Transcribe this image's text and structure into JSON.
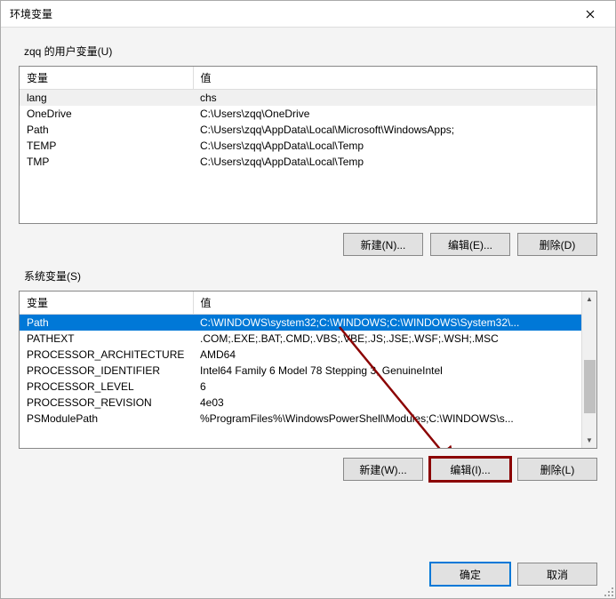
{
  "dialog": {
    "title": "环境变量",
    "close_icon": "close"
  },
  "user_vars": {
    "label": "zqq 的用户变量(U)",
    "headers": {
      "var": "变量",
      "val": "值"
    },
    "rows": [
      {
        "var": "lang",
        "val": "chs",
        "highlighted": true
      },
      {
        "var": "OneDrive",
        "val": "C:\\Users\\zqq\\OneDrive"
      },
      {
        "var": "Path",
        "val": "C:\\Users\\zqq\\AppData\\Local\\Microsoft\\WindowsApps;"
      },
      {
        "var": "TEMP",
        "val": "C:\\Users\\zqq\\AppData\\Local\\Temp"
      },
      {
        "var": "TMP",
        "val": "C:\\Users\\zqq\\AppData\\Local\\Temp"
      }
    ],
    "buttons": {
      "new": "新建(N)...",
      "edit": "编辑(E)...",
      "delete": "删除(D)"
    }
  },
  "system_vars": {
    "label": "系统变量(S)",
    "headers": {
      "var": "变量",
      "val": "值"
    },
    "rows": [
      {
        "var": "Path",
        "val": "C:\\WINDOWS\\system32;C:\\WINDOWS;C:\\WINDOWS\\System32\\...",
        "selected": true
      },
      {
        "var": "PATHEXT",
        "val": ".COM;.EXE;.BAT;.CMD;.VBS;.VBE;.JS;.JSE;.WSF;.WSH;.MSC"
      },
      {
        "var": "PROCESSOR_ARCHITECTURE",
        "val": "AMD64"
      },
      {
        "var": "PROCESSOR_IDENTIFIER",
        "val": "Intel64 Family 6 Model 78 Stepping 3, GenuineIntel"
      },
      {
        "var": "PROCESSOR_LEVEL",
        "val": "6"
      },
      {
        "var": "PROCESSOR_REVISION",
        "val": "4e03"
      },
      {
        "var": "PSModulePath",
        "val": "%ProgramFiles%\\WindowsPowerShell\\Modules;C:\\WINDOWS\\s..."
      }
    ],
    "buttons": {
      "new": "新建(W)...",
      "edit": "编辑(I)...",
      "delete": "删除(L)"
    }
  },
  "footer": {
    "ok": "确定",
    "cancel": "取消"
  }
}
